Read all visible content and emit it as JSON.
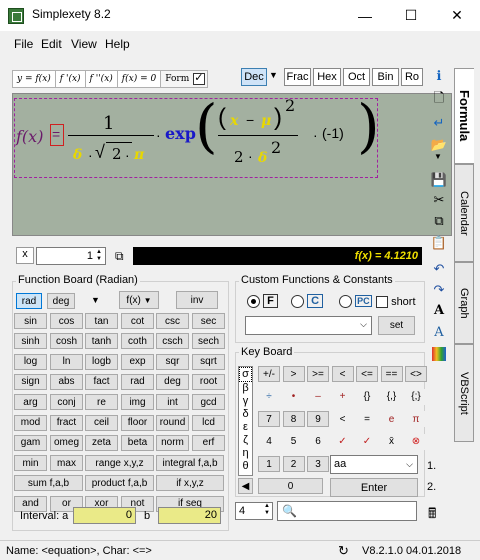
{
  "app": {
    "title": "Simplexety 8.2",
    "min": "—",
    "max": "☐",
    "close": "✕"
  },
  "menu": [
    "File",
    "Edit",
    "View",
    "Help"
  ],
  "ftabs": [
    "y = f(x)",
    "f '(x)",
    "f ''(x)",
    "f(x) = 0",
    "Form"
  ],
  "bases": [
    "Dec",
    "Frac",
    "Hex",
    "Oct",
    "Bin",
    "Ro"
  ],
  "formula": {
    "lhs": "f(x)",
    "eq": "=",
    "num": "1",
    "den_delta": "δ",
    "den_two": "2",
    "den_pi": "π",
    "exp": "exp",
    "x": "x",
    "mu": "μ",
    "pow": "2",
    "two": "2",
    "den2_two": "2",
    "delta2": "δ",
    "neg1": "(-1)",
    "dot": "·",
    "minus": "−",
    "sqrt": "√"
  },
  "xrow": {
    "label": "x",
    "value": "1",
    "result": "f(x)  =  4.1210"
  },
  "fboard": {
    "title": "Function Board (Radian)",
    "rad": "rad",
    "deg": "deg",
    "fx": "f(x)",
    "inv": "inv",
    "rows": [
      [
        "sin",
        "cos",
        "tan",
        "cot",
        "csc",
        "sec"
      ],
      [
        "sinh",
        "cosh",
        "tanh",
        "coth",
        "csch",
        "sech"
      ],
      [
        "log",
        "ln",
        "logb",
        "exp",
        "sqr",
        "sqrt"
      ],
      [
        "sign",
        "abs",
        "fact",
        "rad",
        "deg",
        "root"
      ],
      [
        "arg",
        "conj",
        "re",
        "img",
        "int",
        "gcd"
      ],
      [
        "mod",
        "fract",
        "ceil",
        "floor",
        "round",
        "lcd"
      ],
      [
        "gam",
        "omeg",
        "zeta",
        "beta",
        "norm",
        "erf"
      ],
      [
        "min",
        "max",
        "range x,y,z",
        "integral f,a,b"
      ],
      [
        "sum f,a,b",
        "product f,a,b",
        "if x,y,z"
      ],
      [
        "and",
        "or",
        "xor",
        "not",
        "if seq"
      ]
    ],
    "interval_label": "Interval: a",
    "a": "0",
    "b_label": "b",
    "b": "20"
  },
  "custom": {
    "title": "Custom Functions & Constants",
    "f": "F",
    "c": "C",
    "pc": "PC",
    "short": "short",
    "set": "set"
  },
  "keyboard": {
    "title": "Key Board",
    "greek": [
      "σ",
      "β",
      "γ",
      "δ",
      "ε",
      "ζ",
      "η",
      "θ"
    ],
    "r1": [
      "+/-",
      ">",
      ">=",
      "<",
      "<=",
      "==",
      "<>"
    ],
    "r2": [
      "÷",
      "•",
      "–",
      "+",
      "{}",
      "{,}",
      "{;}"
    ],
    "r3": [
      "7",
      "8",
      "9",
      "<",
      "=",
      "e",
      "π"
    ],
    "r4": [
      "4",
      "5",
      "6",
      "✓",
      "✓",
      "x̄",
      "⊗"
    ],
    "r5": [
      "1",
      "2",
      "3"
    ],
    "aa": "aa",
    "enter": "Enter",
    "zero": "0",
    "one_dot": "1.",
    "two_dot": "2.",
    "spin": "4"
  },
  "vtabs": [
    "Formula",
    "Calendar",
    "Graph",
    "VBScript"
  ],
  "status": {
    "left": "Name: <equation>,  Char: <=>",
    "version": "V8.2.1.0  04.01.2018"
  },
  "colors": {
    "accent": "#0078d7",
    "formula_bg": "#a3b0a0",
    "yellow": "#eaea88"
  }
}
